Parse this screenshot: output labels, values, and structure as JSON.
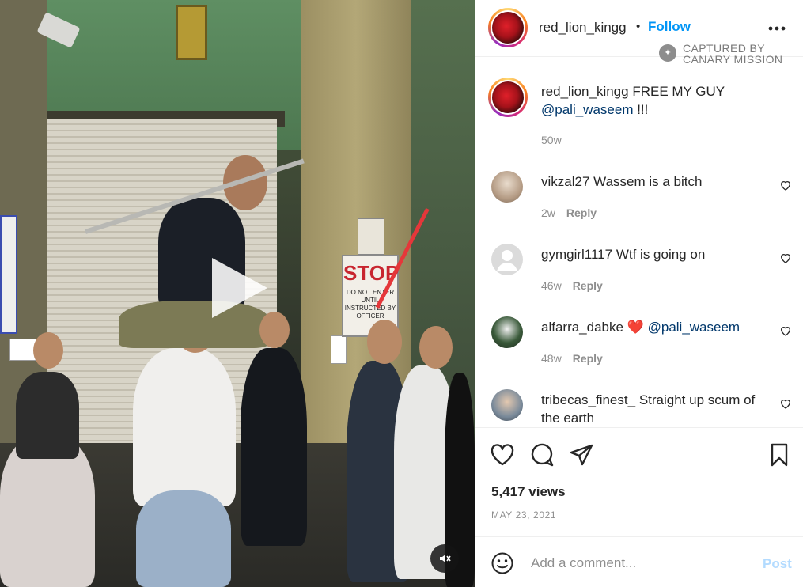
{
  "post": {
    "username": "red_lion_kingg",
    "follow_label": "Follow",
    "more_icon": "more-horizontal-icon",
    "watermark": {
      "line1": "CAPTURED BY",
      "line2": "CANARY MISSION"
    },
    "caption": {
      "username": "red_lion_kingg",
      "text": "FREE MY GUY",
      "mention": "@pali_waseem",
      "suffix": " !!!",
      "time": "50w"
    },
    "comments": [
      {
        "username": "vikzal27",
        "text": "Wassem is a bitch",
        "time": "2w",
        "reply": "Reply",
        "avatar_color": "#c9b8a6"
      },
      {
        "username": "gymgirl1117",
        "text": "Wtf is going on",
        "time": "46w",
        "reply": "Reply",
        "avatar_color": "#dcdcdc"
      },
      {
        "username": "alfarra_dabke",
        "text": "",
        "emoji": "❤️",
        "mention": "@pali_waseem",
        "time": "48w",
        "reply": "Reply",
        "avatar_color": "#3a5a3a"
      },
      {
        "username": "tribecas_finest_",
        "text": "Straight up scum of the earth",
        "time": "",
        "reply": "",
        "avatar_color": "#7a8a9a"
      }
    ],
    "views": "5,417 views",
    "date": "MAY 23, 2021",
    "add_comment_placeholder": "Add a comment...",
    "post_label": "Post"
  },
  "media": {
    "sign_text": "STOP",
    "sign_subtext": "DO NOT ENTER UNTIL INSTRUCTED BY OFFICER",
    "play_icon": "play-icon",
    "mute_icon": "mute-icon"
  },
  "colors": {
    "accent": "#0095f6",
    "mention": "#00376b",
    "secondary_text": "#8e8e8e",
    "post_disabled": "#b3dbff",
    "arrow": "#e5373a"
  }
}
